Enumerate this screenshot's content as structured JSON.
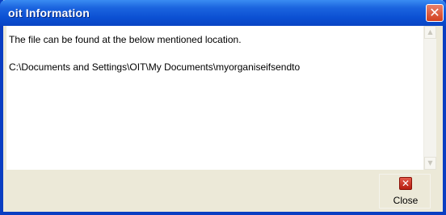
{
  "window": {
    "title": "oit Information",
    "close_glyph": "✕"
  },
  "content": {
    "line1": "The file can be found at the below mentioned location.",
    "line2": "C:\\Documents and Settings\\OIT\\My Documents\\myorganiseifsendto"
  },
  "scrollbar": {
    "up_glyph": "▲",
    "down_glyph": "▼"
  },
  "buttons": {
    "close_label": "Close",
    "close_icon_glyph": "✕"
  },
  "colors": {
    "titlebar": "#0b4fd2",
    "face": "#ece9d8",
    "close_red": "#d2401e"
  }
}
